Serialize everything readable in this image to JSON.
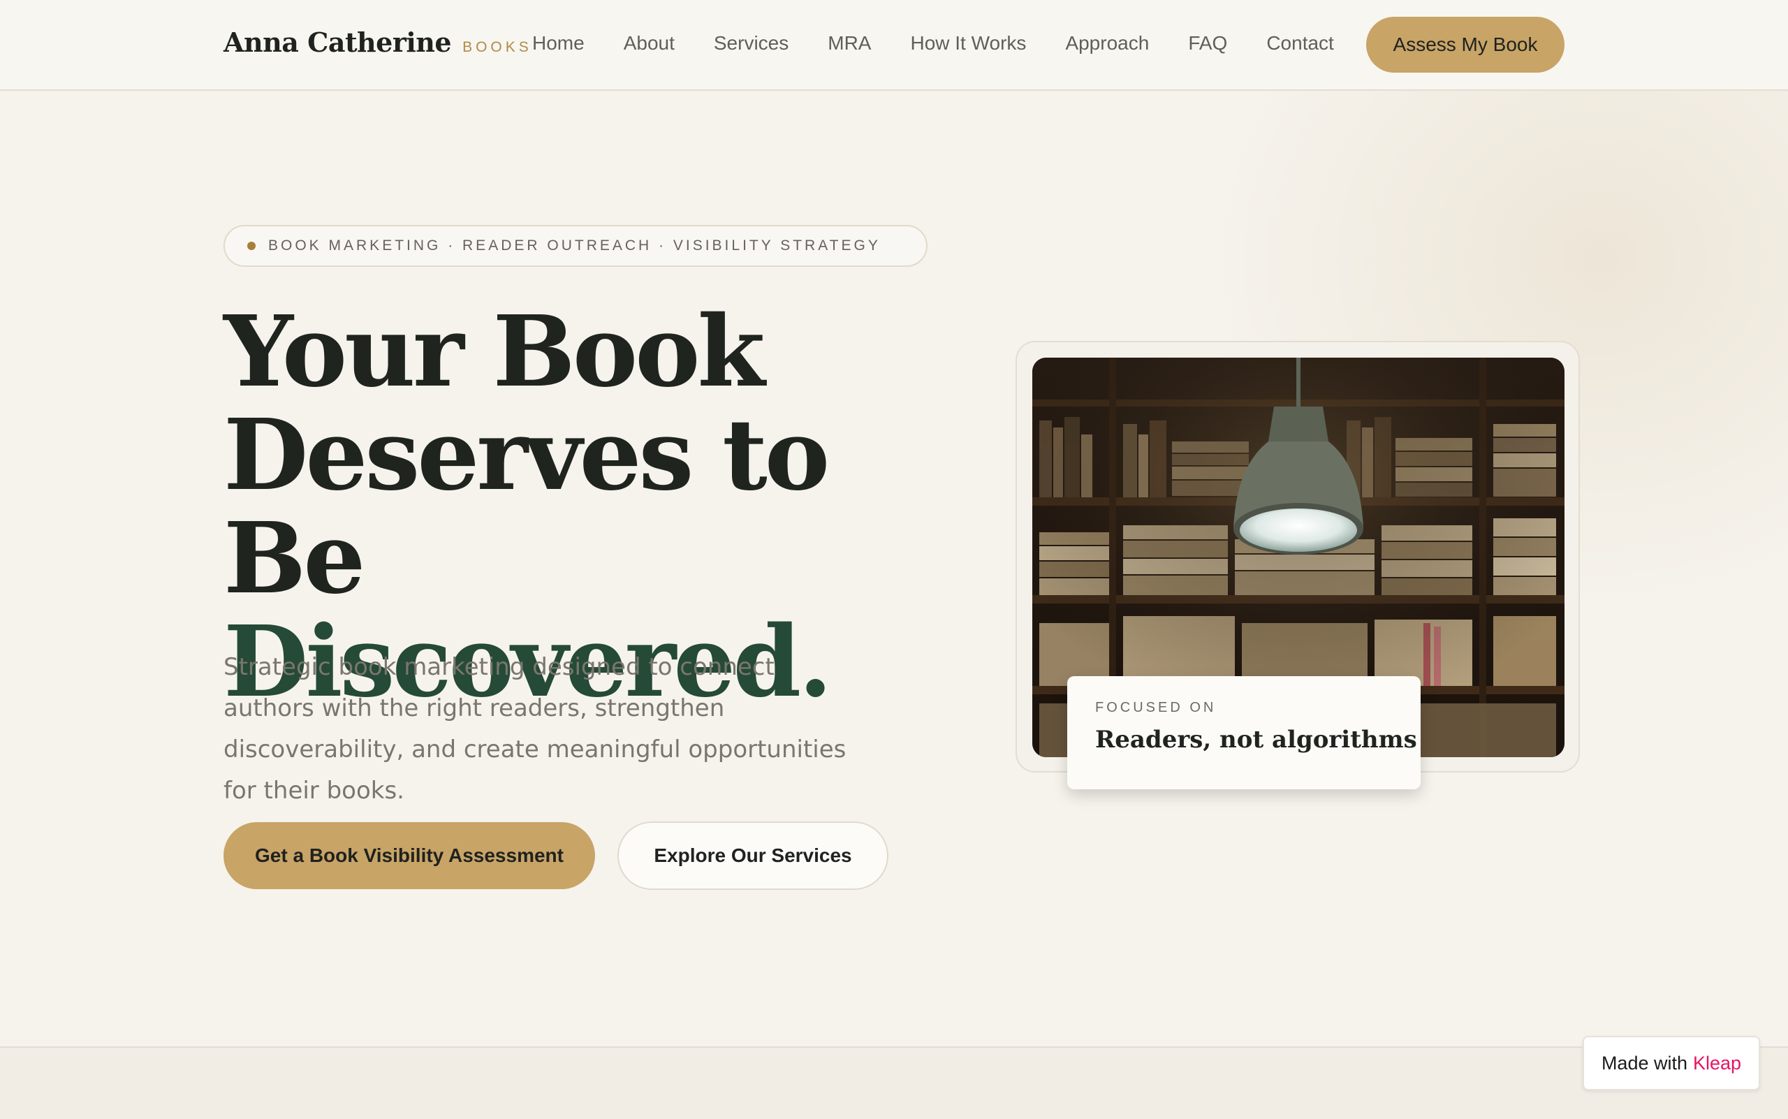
{
  "nav": {
    "brand_name": "Anna Catherine",
    "brand_sub": "BOOKS",
    "links": [
      "Home",
      "About",
      "Services",
      "MRA",
      "How It Works",
      "Approach",
      "FAQ",
      "Contact"
    ],
    "cta": "Assess My Book"
  },
  "hero": {
    "tagline": "BOOK MARKETING · READER OUTREACH · VISIBILITY STRATEGY",
    "headline_line1": "Your Book",
    "headline_line2": "Deserves to Be",
    "headline_line3": "Discovered.",
    "lede": "Strategic book marketing designed to connect authors with the right readers, strengthen discoverability, and create meaningful opportunities for their books.",
    "primary_button": "Get a Book Visibility Assessment",
    "secondary_button": "Explore Our Services"
  },
  "feature_card": {
    "label": "FOCUSED ON",
    "text": "Readers, not algorithms"
  },
  "badge": {
    "prefix": "Made with",
    "brand": "Kleap"
  },
  "colors": {
    "background": "#f6f3ed",
    "accent_gold": "#c8a467",
    "headline_dark": "#20241f",
    "headline_green": "#254a37",
    "badge_pink": "#e8135f"
  }
}
